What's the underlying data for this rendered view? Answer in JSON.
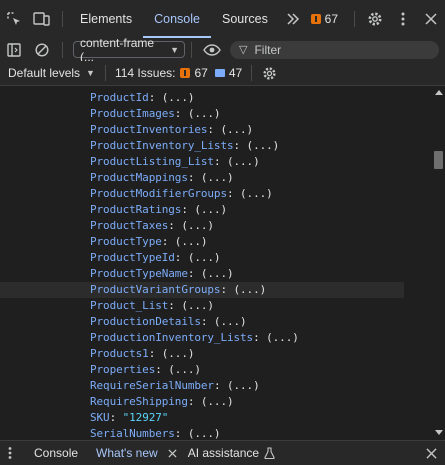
{
  "tabbar": {
    "tabs": [
      {
        "label": "Elements"
      },
      {
        "label": "Console"
      },
      {
        "label": "Sources"
      }
    ],
    "issue_count": "67"
  },
  "toolbar": {
    "context": "content-frame (...",
    "filter_placeholder": "Filter"
  },
  "levels": {
    "label": "Default levels",
    "issues_label": "114 Issues:",
    "warn_count": "67",
    "info_count": "47"
  },
  "console": {
    "lines": [
      {
        "key": "ProductId",
        "rest": ": (...)"
      },
      {
        "key": "ProductImages",
        "rest": ": (...)"
      },
      {
        "key": "ProductInventories",
        "rest": ": (...)"
      },
      {
        "key": "ProductInventory_Lists",
        "rest": ": (...)"
      },
      {
        "key": "ProductListing_List",
        "rest": ": (...)"
      },
      {
        "key": "ProductMappings",
        "rest": ": (...)"
      },
      {
        "key": "ProductModifierGroups",
        "rest": ": (...)"
      },
      {
        "key": "ProductRatings",
        "rest": ": (...)"
      },
      {
        "key": "ProductTaxes",
        "rest": ": (...)"
      },
      {
        "key": "ProductType",
        "rest": ": (...)"
      },
      {
        "key": "ProductTypeId",
        "rest": ": (...)"
      },
      {
        "key": "ProductTypeName",
        "rest": ": (...)"
      },
      {
        "key": "ProductVariantGroups",
        "rest": ": (...)"
      },
      {
        "key": "Product_List",
        "rest": ": (...)"
      },
      {
        "key": "ProductionDetails",
        "rest": ": (...)"
      },
      {
        "key": "ProductionInventory_Lists",
        "rest": ": (...)"
      },
      {
        "key": "Products1",
        "rest": ": (...)"
      },
      {
        "key": "Properties",
        "rest": ": (...)"
      },
      {
        "key": "RequireSerialNumber",
        "rest": ": (...)"
      },
      {
        "key": "RequireShipping",
        "rest": ": (...)"
      },
      {
        "key": "SKU",
        "rest": ": ",
        "str": "\"12927\""
      },
      {
        "key": "SerialNumbers",
        "rest": ": (...)"
      }
    ]
  },
  "drawer": {
    "tabs": [
      {
        "label": "Console"
      },
      {
        "label": "What's new"
      },
      {
        "label": "AI assistance"
      }
    ]
  },
  "colors": {
    "accent": "#a8c7fa",
    "key": "#7cacf8",
    "string": "#5cd5fb",
    "warning": "#e8710a"
  }
}
